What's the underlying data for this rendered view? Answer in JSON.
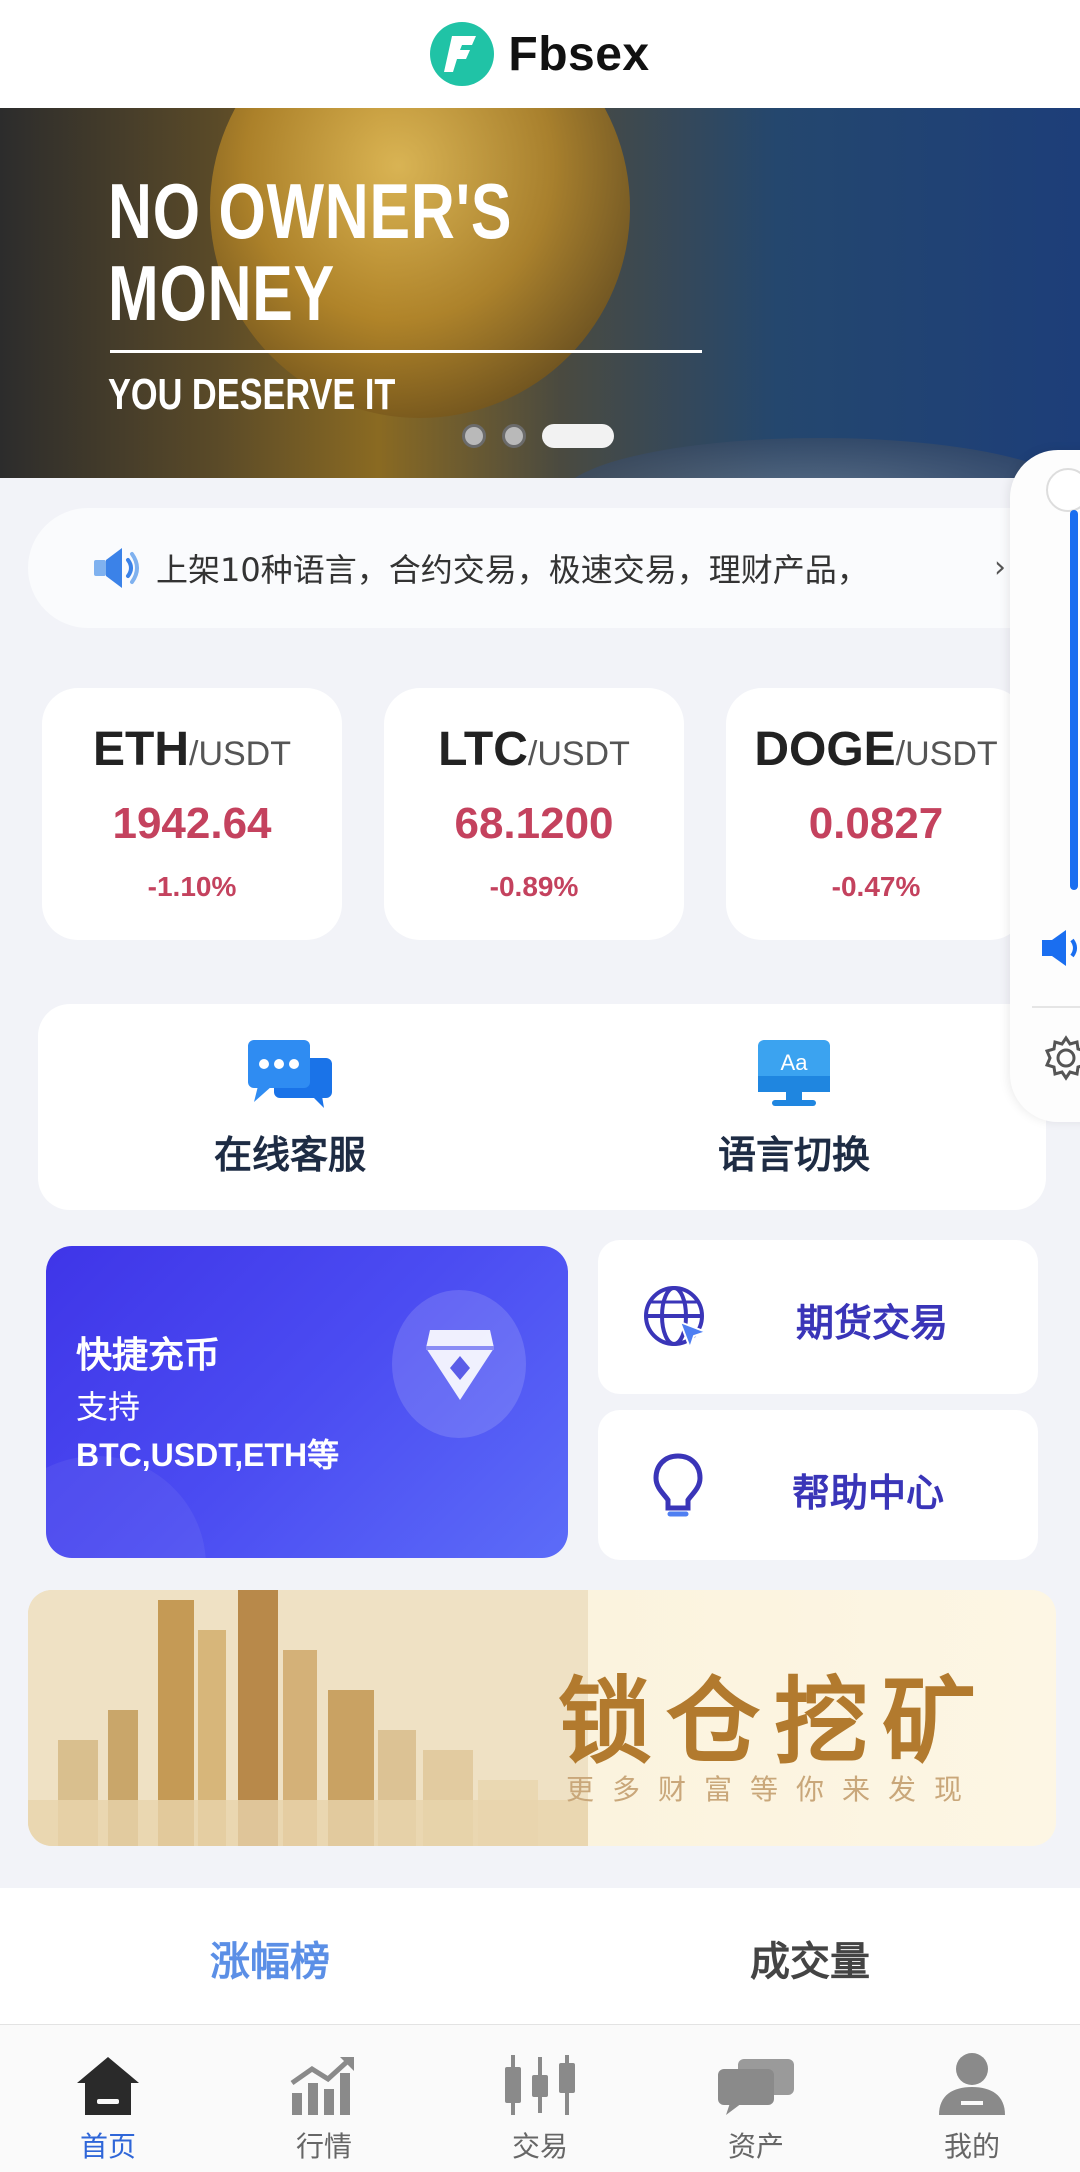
{
  "header": {
    "brand": "Fbsex",
    "logo_letter": "F"
  },
  "banner": {
    "title_line1": "NO OWNER'S",
    "title_line2": "MONEY",
    "subtitle": "YOU DESERVE IT",
    "slide_count": 3,
    "active_slide": 3
  },
  "notice": {
    "icon": "speaker-icon",
    "text": "上架10种语言，合约交易，极速交易，理财产品，"
  },
  "tickers": [
    {
      "base": "ETH",
      "quote": "/USDT",
      "price": "1942.64",
      "change": "-1.10%"
    },
    {
      "base": "LTC",
      "quote": "/USDT",
      "price": "68.1200",
      "change": "-0.89%"
    },
    {
      "base": "DOGE",
      "quote": "/USDT",
      "price": "0.0827",
      "change": "-0.47%"
    }
  ],
  "services": [
    {
      "label": "在线客服",
      "icon": "chat-bubble-icon"
    },
    {
      "label": "语言切换",
      "icon": "language-monitor-icon"
    }
  ],
  "quick_deposit": {
    "title": "快捷充币",
    "line1": "支持",
    "line2": "BTC,USDT,ETH等"
  },
  "side_cards": [
    {
      "label": "期货交易",
      "icon": "globe-cursor-icon"
    },
    {
      "label": "帮助中心",
      "icon": "lightbulb-icon"
    }
  ],
  "mining_banner": {
    "title": "锁仓挖矿",
    "subtitle": "更多财富等你来发现"
  },
  "tabs": [
    {
      "label": "涨幅榜",
      "active": true
    },
    {
      "label": "成交量",
      "active": false
    }
  ],
  "bottom_nav": [
    {
      "label": "首页",
      "icon": "home-icon",
      "active": true
    },
    {
      "label": "行情",
      "icon": "chart-icon",
      "active": false
    },
    {
      "label": "交易",
      "icon": "candlestick-icon",
      "active": false
    },
    {
      "label": "资产",
      "icon": "chat-icon",
      "active": false
    },
    {
      "label": "我的",
      "icon": "user-icon",
      "active": false
    }
  ],
  "colors": {
    "accent": "#2f66d8",
    "price_down": "#c4425e",
    "brand": "#20c3a6",
    "deposit_gradient": "#4b4cf2"
  }
}
